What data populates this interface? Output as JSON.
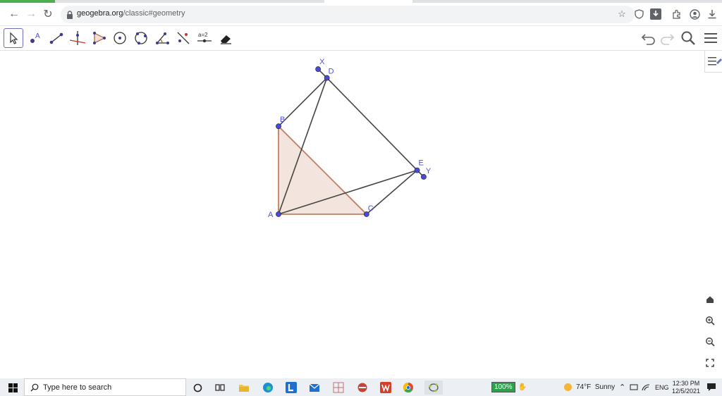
{
  "browser": {
    "url_domain": "geogebra.org",
    "url_path": "/classic#geometry"
  },
  "toolbar": {
    "tools": [
      {
        "name": "move-tool-icon",
        "selected": true
      },
      {
        "name": "point-tool-icon"
      },
      {
        "name": "segment-tool-icon"
      },
      {
        "name": "perpendicular-line-tool-icon"
      },
      {
        "name": "polygon-tool-icon"
      },
      {
        "name": "circle-center-point-tool-icon"
      },
      {
        "name": "circle-three-points-tool-icon"
      },
      {
        "name": "angle-tool-icon"
      },
      {
        "name": "reflect-tool-icon"
      },
      {
        "name": "slider-tool-icon",
        "label": "a=2"
      },
      {
        "name": "eraser-tool-icon"
      }
    ]
  },
  "construction": {
    "points": [
      {
        "label": "A",
        "x": 0,
        "y": 0
      },
      {
        "label": "B",
        "x": 0,
        "y": 4
      },
      {
        "label": "C",
        "x": 4,
        "y": 0
      },
      {
        "label": "D",
        "x": 2.2,
        "y": 6.2
      },
      {
        "label": "E",
        "x": 6.3,
        "y": 2
      },
      {
        "label": "X",
        "x": 1.8,
        "y": 6.6
      },
      {
        "label": "Y",
        "x": 6.6,
        "y": 1.7
      }
    ],
    "polygon": [
      "A",
      "B",
      "C"
    ],
    "segments": [
      [
        "B",
        "D"
      ],
      [
        "A",
        "D"
      ],
      [
        "D",
        "E"
      ],
      [
        "A",
        "E"
      ],
      [
        "C",
        "E"
      ],
      [
        "X",
        "D"
      ],
      [
        "E",
        "Y"
      ]
    ],
    "colors": {
      "polygon_fill": "#f3e5de",
      "polygon_stroke": "#c08060",
      "segment": "#444444",
      "point": "#4a4ad8",
      "label": "#5252d6"
    }
  },
  "taskbar": {
    "search_placeholder": "Type here to search",
    "battery": "100%",
    "weather": "74°F  Sunny",
    "language": "ENG",
    "time": "12:30 PM",
    "date": "12/5/2021"
  }
}
